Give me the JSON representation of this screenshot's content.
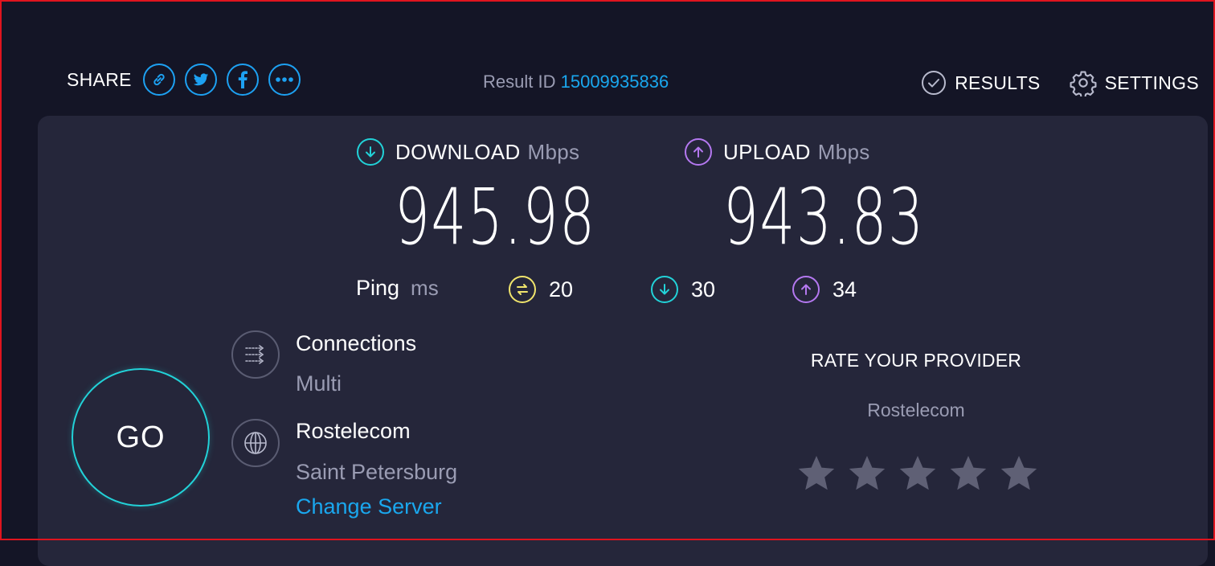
{
  "header": {
    "share_label": "SHARE",
    "share_buttons": [
      {
        "icon": "link-icon"
      },
      {
        "icon": "twitter-icon"
      },
      {
        "icon": "facebook-icon"
      },
      {
        "icon": "more-icon"
      }
    ],
    "result_id_label": "Result ID",
    "result_id_value": "15009935836",
    "results_label": "RESULTS",
    "settings_label": "SETTINGS"
  },
  "download": {
    "label": "DOWNLOAD",
    "unit": "Mbps",
    "value": "945.98",
    "color": "#22d2d8"
  },
  "upload": {
    "label": "UPLOAD",
    "unit": "Mbps",
    "value": "943.83",
    "color": "#b478f0"
  },
  "ping": {
    "label": "Ping",
    "unit": "ms",
    "idle": {
      "value": "20",
      "color": "#f0e46c"
    },
    "download": {
      "value": "30",
      "color": "#22d2d8"
    },
    "upload": {
      "value": "34",
      "color": "#b478f0"
    }
  },
  "connections": {
    "title": "Connections",
    "value": "Multi"
  },
  "server": {
    "name": "Rostelecom",
    "location": "Saint Petersburg",
    "change_label": "Change Server"
  },
  "go_label": "GO",
  "rate": {
    "title": "RATE YOUR PROVIDER",
    "provider": "Rostelecom",
    "stars_total": 5,
    "stars_selected": 0
  },
  "colors": {
    "accent_blue": "#1aa7ee",
    "background": "#141526",
    "panel": "#25263a",
    "muted_text": "#9a9cb3",
    "frame": "#e0141e"
  }
}
